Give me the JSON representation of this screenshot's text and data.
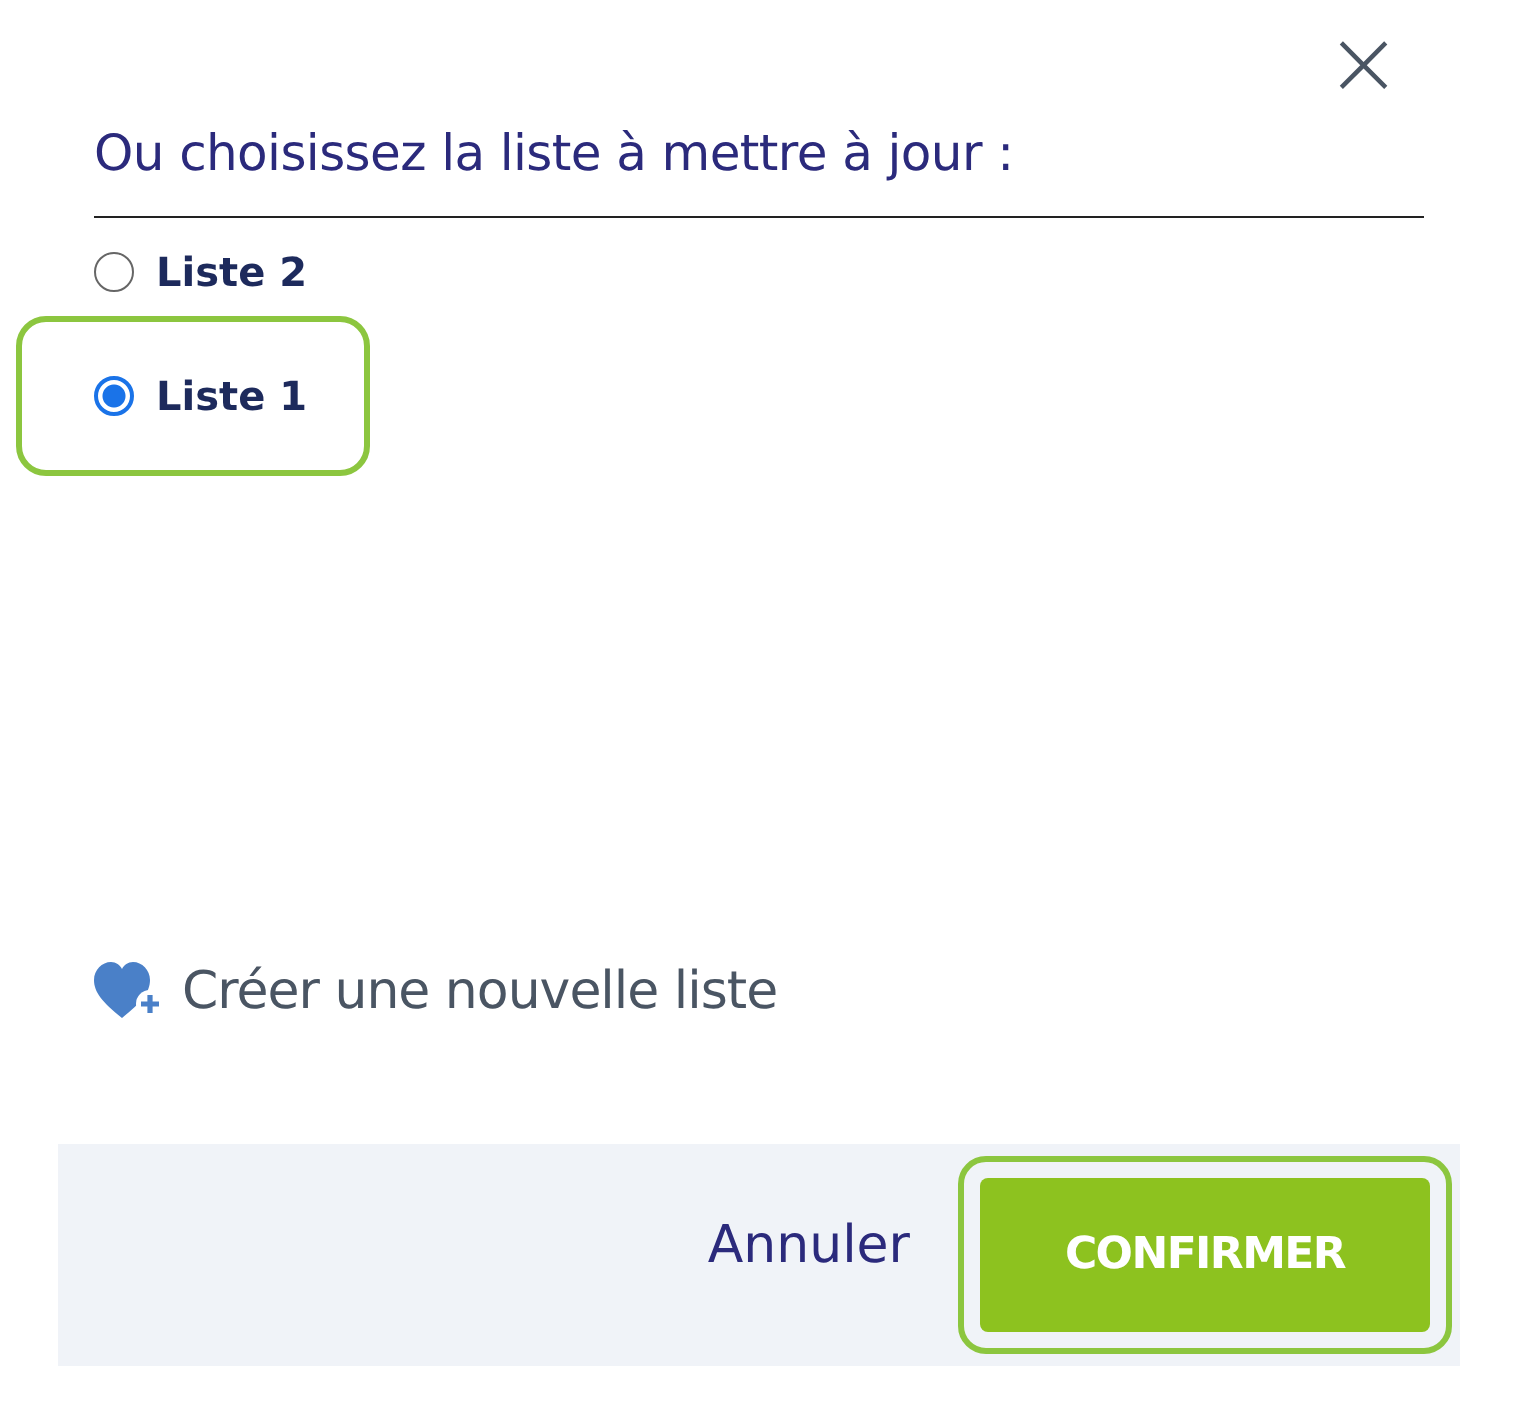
{
  "close_label": "×",
  "title": "Ou choisissez la liste à mettre à jour :",
  "options": [
    {
      "label": "Liste 2",
      "selected": false,
      "highlighted": false
    },
    {
      "label": "Liste 1",
      "selected": true,
      "highlighted": true
    }
  ],
  "create_link": "Créer une nouvelle liste",
  "footer": {
    "cancel": "Annuler",
    "confirm": {
      "label": "CONFIRMER",
      "highlighted": true
    }
  }
}
